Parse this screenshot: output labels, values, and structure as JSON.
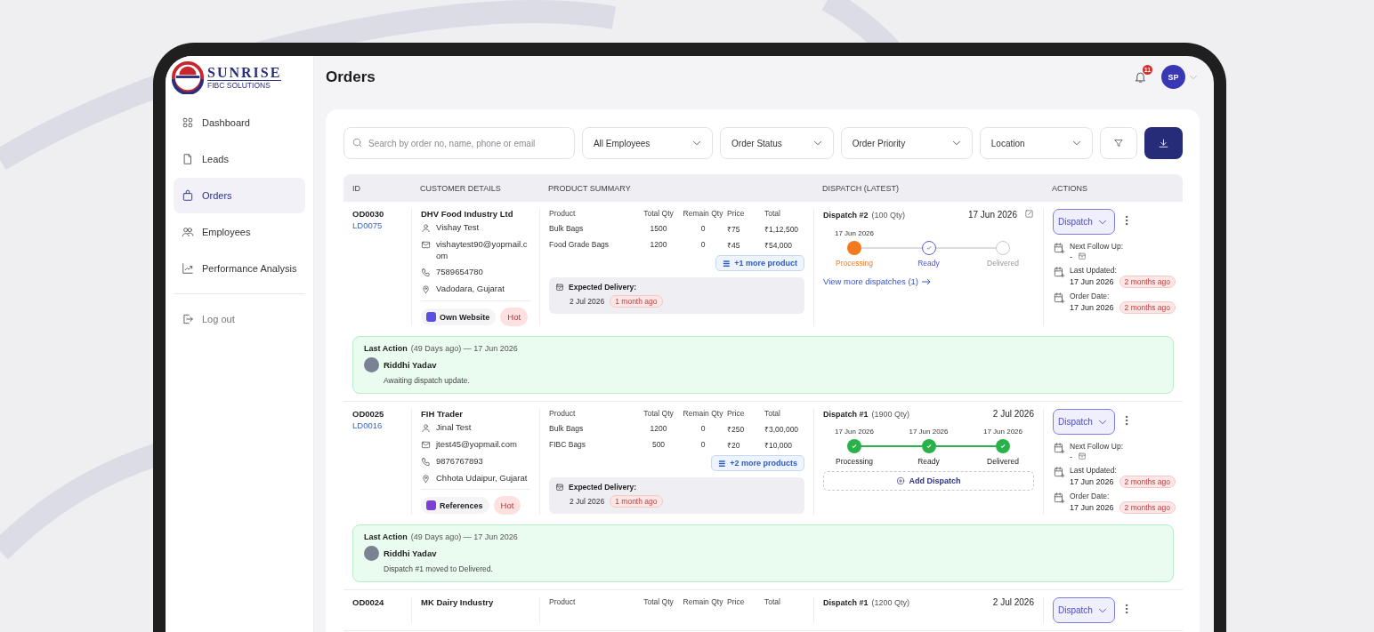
{
  "brand": {
    "name": "SUNRISE",
    "tagline": "FIBC SOLUTIONS"
  },
  "sidebar": {
    "items": [
      {
        "label": "Dashboard",
        "selected": false
      },
      {
        "label": "Leads",
        "selected": false
      },
      {
        "label": "Orders",
        "selected": true
      },
      {
        "label": "Employees",
        "selected": false
      },
      {
        "label": "Performance Analysis",
        "selected": false
      }
    ],
    "logout": "Log out"
  },
  "header": {
    "title": "Orders",
    "notification_count": "11",
    "avatar_initials": "SP"
  },
  "filters": {
    "search_placeholder": "Search by order no, name, phone or email",
    "dropdowns": [
      "All Employees",
      "Order Status",
      "Order Priority",
      "Location"
    ]
  },
  "table": {
    "columns": [
      "ID",
      "CUSTOMER DETAILS",
      "PRODUCT SUMMARY",
      "DISPATCH (LATEST)",
      "ACTIONS"
    ],
    "rows": [
      {
        "id": "OD0030",
        "lead_id": "LD0075",
        "customer": {
          "name": "DHV Food Industry Ltd",
          "contact": "Vishay Test",
          "email": "vishaytest90@yopmail.com",
          "phone": "7589654780",
          "location": "Vadodara, Gujarat"
        },
        "source": {
          "label": "Own Website",
          "kind": "website"
        },
        "priority": "Hot",
        "product_columns": [
          "Product",
          "Total Qty",
          "Remain Qty",
          "Price",
          "Total"
        ],
        "products": [
          {
            "name": "Bulk Bags",
            "total_qty": "1500",
            "remain_qty": "0",
            "price": "₹75",
            "total": "₹1,12,500"
          },
          {
            "name": "Food Grade Bags",
            "total_qty": "1200",
            "remain_qty": "0",
            "price": "₹45",
            "total": "₹54,000"
          }
        ],
        "more_products": "+1 more product",
        "expected_delivery": {
          "label": "Expected Delivery:",
          "date": "2 Jul 2026",
          "ago": "1 month ago"
        },
        "dispatch": {
          "title": "Dispatch #2",
          "qty": "(100 Qty)",
          "date": "17 Jun 2026",
          "editable": true,
          "steps": [
            {
              "label": "Processing",
              "date": "17 Jun 2026",
              "kind": "current"
            },
            {
              "label": "Ready",
              "kind": "next"
            },
            {
              "label": "Delivered",
              "kind": "pending"
            }
          ],
          "footer": {
            "kind": "link",
            "label": "View more dispatches (1)"
          }
        },
        "actions": {
          "button": "Dispatch",
          "next_follow_up": {
            "label": "Next Follow Up:",
            "value": "-"
          },
          "last_updated": {
            "label": "Last Updated:",
            "date": "17 Jun 2026",
            "ago": "2 months ago"
          },
          "order_date": {
            "label": "Order Date:",
            "date": "17 Jun 2026",
            "ago": "2 months ago"
          }
        },
        "last_action": {
          "label": "Last Action",
          "meta": "(49 Days ago) — 17 Jun 2026",
          "user": "Riddhi Yadav",
          "note": "Awaiting dispatch update."
        }
      },
      {
        "id": "OD0025",
        "lead_id": "LD0016",
        "customer": {
          "name": "FIH Trader",
          "contact": "Jinal Test",
          "email": "jtest45@yopmail.com",
          "phone": "9876767893",
          "location": "Chhota Udaipur, Gujarat"
        },
        "source": {
          "label": "References",
          "kind": "references"
        },
        "priority": "Hot",
        "product_columns": [
          "Product",
          "Total Qty",
          "Remain Qty",
          "Price",
          "Total"
        ],
        "products": [
          {
            "name": "Bulk Bags",
            "total_qty": "1200",
            "remain_qty": "0",
            "price": "₹250",
            "total": "₹3,00,000"
          },
          {
            "name": "FIBC Bags",
            "total_qty": "500",
            "remain_qty": "0",
            "price": "₹20",
            "total": "₹10,000"
          }
        ],
        "more_products": "+2 more products",
        "expected_delivery": {
          "label": "Expected Delivery:",
          "date": "2 Jul 2026",
          "ago": "1 month ago"
        },
        "dispatch": {
          "title": "Dispatch #1",
          "qty": "(1900 Qty)",
          "date": "2 Jul 2026",
          "editable": false,
          "steps": [
            {
              "label": "Processing",
              "date": "17 Jun 2026",
              "kind": "done"
            },
            {
              "label": "Ready",
              "date": "17 Jun 2026",
              "kind": "done"
            },
            {
              "label": "Delivered",
              "date": "17 Jun 2026",
              "kind": "done"
            }
          ],
          "footer": {
            "kind": "button",
            "label": "Add Dispatch"
          }
        },
        "actions": {
          "button": "Dispatch",
          "next_follow_up": {
            "label": "Next Follow Up:",
            "value": "-"
          },
          "last_updated": {
            "label": "Last Updated:",
            "date": "17 Jun 2026",
            "ago": "2 months ago"
          },
          "order_date": {
            "label": "Order Date:",
            "date": "17 Jun 2026",
            "ago": "2 months ago"
          }
        },
        "last_action": {
          "label": "Last Action",
          "meta": "(49 Days ago) — 17 Jun 2026",
          "user": "Riddhi Yadav",
          "note": "Dispatch #1 moved to Delivered."
        }
      },
      {
        "id": "OD0024",
        "customer": {
          "name": "MK Dairy Industry"
        },
        "product_columns": [
          "Product",
          "Total Qty",
          "Remain Qty",
          "Price",
          "Total"
        ],
        "dispatch": {
          "title": "Dispatch #1",
          "qty": "(1200 Qty)",
          "date": "2 Jul 2026",
          "editable": false
        },
        "actions": {
          "button": "Dispatch"
        }
      }
    ]
  }
}
